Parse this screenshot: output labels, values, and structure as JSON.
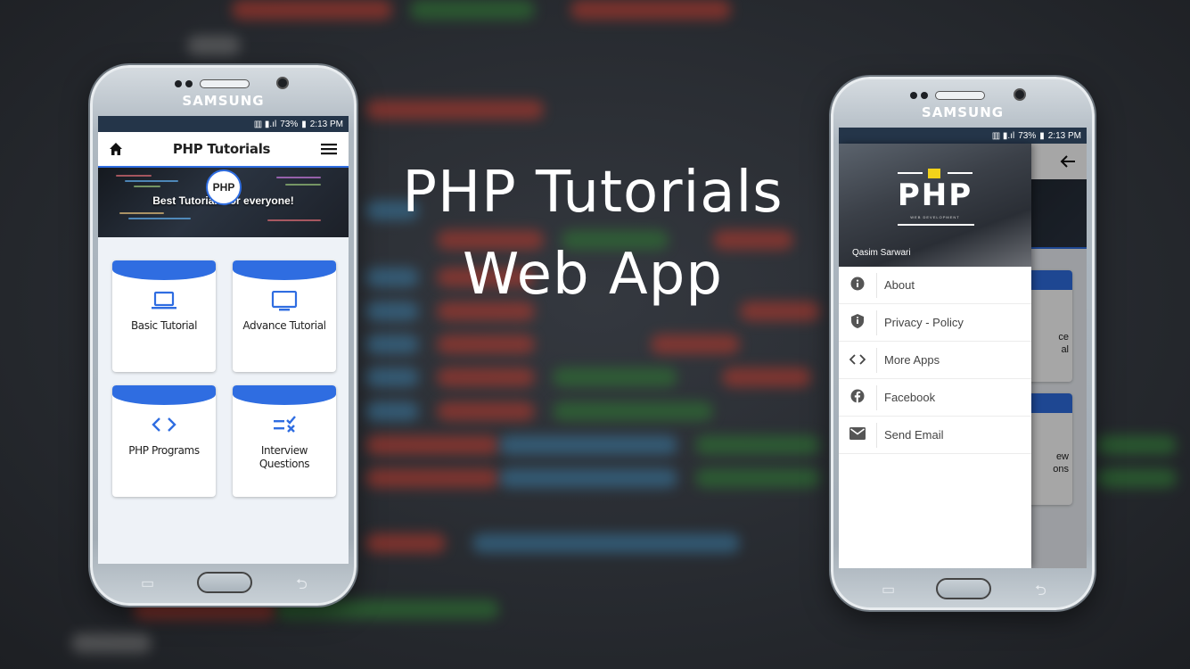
{
  "hero": {
    "line1": "PHP Tutorials",
    "line2": "Web App"
  },
  "device": {
    "brand": "SAMSUNG"
  },
  "status": {
    "battery": "73%",
    "time": "2:13 PM"
  },
  "left_app": {
    "title": "PHP Tutorials",
    "slogan": "Best Tutorials for everyone!",
    "badge": "PHP",
    "cards": [
      {
        "label": "Basic Tutorial",
        "icon": "laptop-icon"
      },
      {
        "label": "Advance Tutorial",
        "icon": "monitor-icon"
      },
      {
        "label": "PHP Programs",
        "icon": "code-icon"
      },
      {
        "label": "Interview Questions",
        "icon": "checklist-icon"
      }
    ]
  },
  "right_app": {
    "drawer": {
      "logo_text": "PHP",
      "logo_sub": "WEB DEVELOPMENT",
      "user": "Qasim Sarwari",
      "items": [
        {
          "label": "About",
          "icon": "info-icon"
        },
        {
          "label": "Privacy - Policy",
          "icon": "shield-icon"
        },
        {
          "label": "More Apps",
          "icon": "code-icon"
        },
        {
          "label": "Facebook",
          "icon": "facebook-icon"
        },
        {
          "label": "Send Email",
          "icon": "mail-icon"
        }
      ]
    },
    "peek": {
      "card1": "ce\nal",
      "card2": "ew\nons"
    }
  },
  "colors": {
    "accent": "#2f6de1",
    "statusbar": "#243549"
  }
}
